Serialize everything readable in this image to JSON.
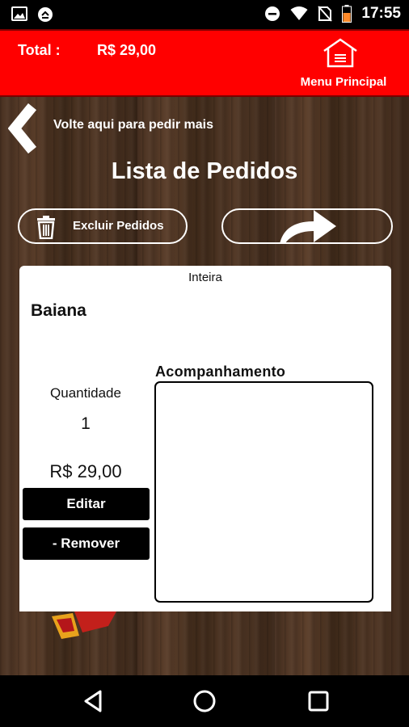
{
  "status_bar": {
    "time": "17:55",
    "icons": [
      "image-icon",
      "sync-icon",
      "minus-circle-icon",
      "wifi-icon",
      "no-sim-icon",
      "battery-icon"
    ]
  },
  "header": {
    "total_label": "Total :",
    "total_value": "R$ 29,00",
    "menu_label": "Menu Principal",
    "menu_icon": "house-icon",
    "background_color": "#ff0000"
  },
  "back_link": {
    "text": "Volte aqui para pedir mais",
    "icon": "chevron-left-icon"
  },
  "page_title": "Lista de Pedidos",
  "actions": {
    "delete_label": "Excluir Pedidos",
    "delete_icon": "trash-icon",
    "next_icon": "share-arrow-icon"
  },
  "order_item": {
    "size_label": "Inteira",
    "name": "Baiana",
    "quantity_label": "Quantidade",
    "quantity_value": "1",
    "price": "R$ 29,00",
    "edit_label": "Editar",
    "remove_label": "- Remover",
    "accompaniment_label": "Acompanhamento",
    "accompaniment_value": ""
  },
  "nav_bar": {
    "icons": [
      "nav-back-icon",
      "nav-home-icon",
      "nav-recent-icon"
    ]
  }
}
